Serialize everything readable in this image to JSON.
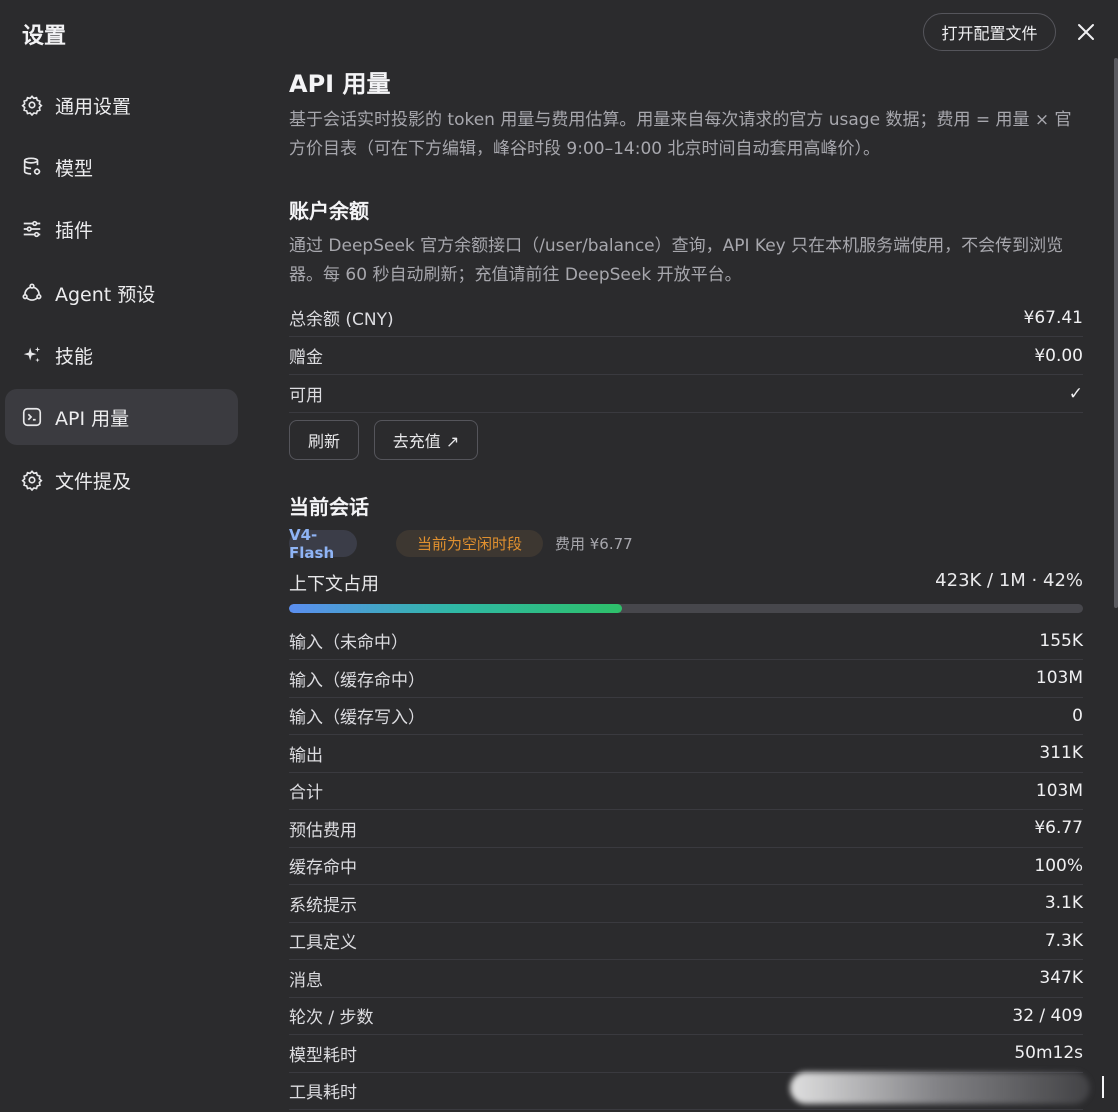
{
  "app": {
    "title": "设置"
  },
  "sidebar": {
    "items": [
      {
        "label": "通用设置",
        "icon": "gear-icon"
      },
      {
        "label": "模型",
        "icon": "database-icon"
      },
      {
        "label": "插件",
        "icon": "sliders-icon"
      },
      {
        "label": "Agent 预设",
        "icon": "agent-icon"
      },
      {
        "label": "技能",
        "icon": "sparkle-icon"
      },
      {
        "label": "API 用量",
        "icon": "terminal-icon",
        "active": true
      },
      {
        "label": "文件提及",
        "icon": "gear-icon"
      }
    ]
  },
  "header": {
    "open_config_label": "打开配置文件",
    "close_icon": "close-icon"
  },
  "main": {
    "title": "API 用量",
    "description": "基于会话实时投影的 token 用量与费用估算。用量来自每次请求的官方 usage 数据；费用 = 用量 × 官方价目表（可在下方编辑，峰谷时段 9:00–14:00 北京时间自动套用高峰价）。"
  },
  "balance": {
    "title": "账户余额",
    "description": "通过 DeepSeek 官方余额接口（/user/balance）查询，API Key 只在本机服务端使用，不会传到浏览器。每 60 秒自动刷新；充值请前往 DeepSeek 开放平台。",
    "rows": [
      {
        "label": "总余额 (CNY)",
        "value": "¥67.41"
      },
      {
        "label": "赠金",
        "value": "¥0.00"
      },
      {
        "label": "可用",
        "value": "✓"
      }
    ],
    "refresh_label": "刷新",
    "topup_label": "去充值 ↗"
  },
  "session": {
    "title": "当前会话",
    "model_badge": "V4-Flash",
    "period_badge": "当前为空闲时段",
    "cost_inline": "费用 ¥6.77",
    "context_label": "上下文占用",
    "context_value": "423K / 1M · 42%",
    "context_fraction": 0.42,
    "rows": [
      {
        "label": "输入（未命中）",
        "value": "155K"
      },
      {
        "label": "输入（缓存命中）",
        "value": "103M"
      },
      {
        "label": "输入（缓存写入）",
        "value": "0"
      },
      {
        "label": "输出",
        "value": "311K"
      },
      {
        "label": "合计",
        "value": "103M"
      },
      {
        "label": "预估费用",
        "value": "¥6.77"
      },
      {
        "label": "缓存命中",
        "value": "100%"
      },
      {
        "label": "系统提示",
        "value": "3.1K"
      },
      {
        "label": "工具定义",
        "value": "7.3K"
      },
      {
        "label": "消息",
        "value": "347K"
      },
      {
        "label": "轮次 / 步数",
        "value": "32 / 409"
      },
      {
        "label": "模型耗时",
        "value": "50m12s"
      },
      {
        "label": "工具耗时",
        "value": ""
      }
    ]
  },
  "colors": {
    "background": "#2b2b2d",
    "active_nav": "#3b3b40",
    "model_badge_text": "#8fb4f5",
    "period_badge_text": "#e0902f",
    "progress_start": "#5b8ef0",
    "progress_end": "#2ec06a"
  }
}
